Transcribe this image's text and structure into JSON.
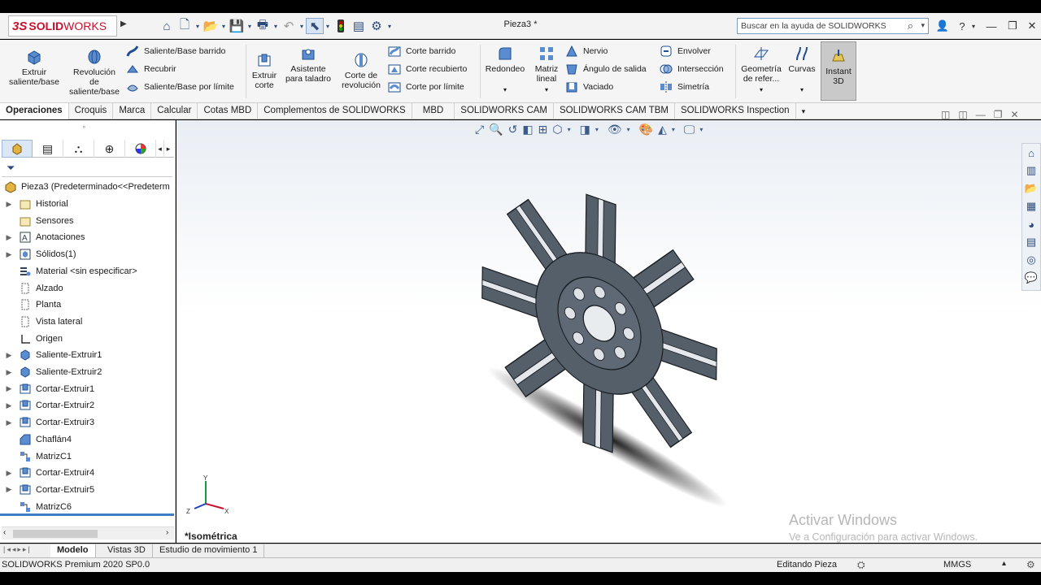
{
  "app": {
    "brand_mark": "3S",
    "brand_bold": "SOLID",
    "brand_light": "WORKS",
    "doc_title": "Pieza3 *",
    "search_placeholder": "Buscar en la ayuda de SOLIDWORKS",
    "help_label": "?",
    "accent": "#c8102e"
  },
  "ribbon": {
    "extruir_saliente": "Extruir\nsaliente/base",
    "revolucion_saliente": "Revolución\nde\nsaliente/base",
    "saliente_barrido": "Saliente/Base barrido",
    "recubrir": "Recubrir",
    "saliente_limite": "Saliente/Base por límite",
    "extruir_corte": "Extruir\ncorte",
    "asistente_taladro": "Asistente\npara taladro",
    "corte_revolucion": "Corte de\nrevolución",
    "corte_barrido": "Corte barrido",
    "corte_recubierto": "Corte recubierto",
    "corte_limite": "Corte por límite",
    "redondeo": "Redondeo",
    "matriz_lineal": "Matriz\nlineal",
    "nervio": "Nervio",
    "angulo_salida": "Ángulo de salida",
    "vaciado": "Vaciado",
    "envolver": "Envolver",
    "interseccion": "Intersección",
    "simetria": "Simetría",
    "geometria_referencia": "Geometría\nde refer...",
    "curvas": "Curvas",
    "instant3d": "Instant\n3D"
  },
  "tabs": [
    "Operaciones",
    "Croquis",
    "Marca",
    "Calcular",
    "Cotas MBD",
    "Complementos de SOLIDWORKS",
    "MBD",
    "SOLIDWORKS CAM",
    "SOLIDWORKS CAM TBM",
    "SOLIDWORKS Inspection"
  ],
  "tree": {
    "root": "Pieza3  (Predeterminado<<Predeterm",
    "items": [
      {
        "label": "Historial",
        "icon": "history-folder-icon",
        "arrow": true
      },
      {
        "label": "Sensores",
        "icon": "sensors-icon",
        "arrow": false
      },
      {
        "label": "Anotaciones",
        "icon": "annotations-icon",
        "arrow": true
      },
      {
        "label": "Sólidos(1)",
        "icon": "solid-bodies-icon",
        "arrow": true
      },
      {
        "label": "Material <sin especificar>",
        "icon": "material-icon",
        "arrow": false
      },
      {
        "label": "Alzado",
        "icon": "plane-icon",
        "arrow": false
      },
      {
        "label": "Planta",
        "icon": "plane-icon",
        "arrow": false
      },
      {
        "label": "Vista lateral",
        "icon": "plane-icon",
        "arrow": false
      },
      {
        "label": "Origen",
        "icon": "origin-icon",
        "arrow": false
      },
      {
        "label": "Saliente-Extruir1",
        "icon": "boss-extrude-icon",
        "arrow": true
      },
      {
        "label": "Saliente-Extruir2",
        "icon": "boss-extrude-icon",
        "arrow": true
      },
      {
        "label": "Cortar-Extruir1",
        "icon": "cut-extrude-icon",
        "arrow": true
      },
      {
        "label": "Cortar-Extruir2",
        "icon": "cut-extrude-icon",
        "arrow": true
      },
      {
        "label": "Cortar-Extruir3",
        "icon": "cut-extrude-icon",
        "arrow": true
      },
      {
        "label": "Chaflán4",
        "icon": "chamfer-icon",
        "arrow": false
      },
      {
        "label": "MatrizC1",
        "icon": "circular-pattern-icon",
        "arrow": false
      },
      {
        "label": "Cortar-Extruir4",
        "icon": "cut-extrude-icon",
        "arrow": true
      },
      {
        "label": "Cortar-Extruir5",
        "icon": "cut-extrude-icon",
        "arrow": true
      },
      {
        "label": "MatrizC6",
        "icon": "circular-pattern-icon",
        "arrow": false
      }
    ]
  },
  "viewport": {
    "view_name": "*Isométrica",
    "axis_x": "X",
    "axis_y": "Y",
    "axis_z": "Z",
    "watermark_title": "Activar Windows",
    "watermark_sub": "Ve a Configuración para activar Windows."
  },
  "bottom_tabs": [
    "Modelo",
    "Vistas 3D",
    "Estudio de movimiento 1"
  ],
  "status": {
    "left": "SOLIDWORKS Premium 2020 SP0.0",
    "mode": "Editando Pieza",
    "units": "MMGS"
  }
}
